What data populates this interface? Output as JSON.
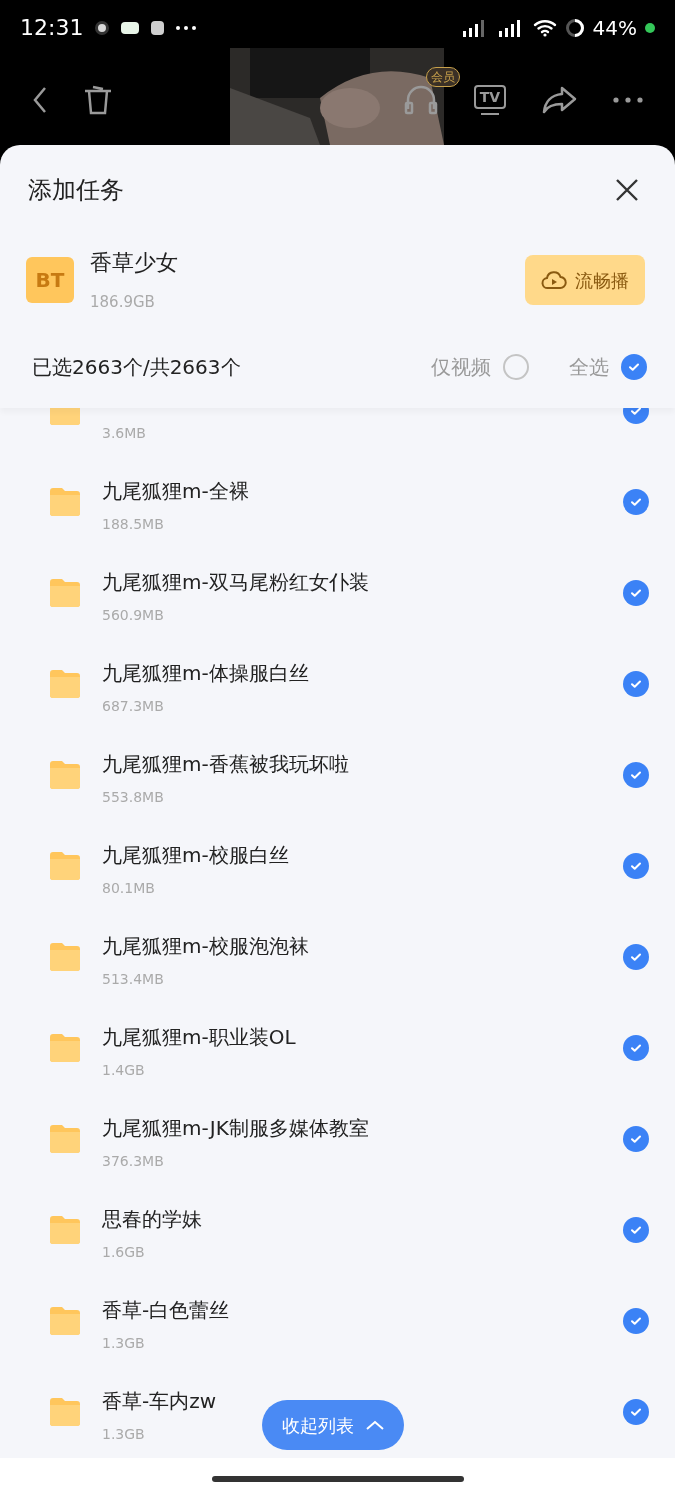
{
  "status_bar": {
    "time": "12:31",
    "battery": "44%"
  },
  "toolbar": {
    "vip_badge": "会员",
    "tv_label": "TV"
  },
  "sheet": {
    "title": "添加任务",
    "torrent": {
      "badge": "BT",
      "name": "香草少女",
      "size": "186.9GB",
      "play_button": "流畅播"
    },
    "selection": {
      "summary": "已选2663个/共2663个",
      "video_only": {
        "label": "仅视频",
        "checked": false
      },
      "select_all": {
        "label": "全选",
        "checked": true
      }
    },
    "items": [
      {
        "size": "3.6MB",
        "checked": true
      },
      {
        "name": "九尾狐狸m-全裸",
        "size": "188.5MB",
        "checked": true
      },
      {
        "name": "九尾狐狸m-双马尾粉红女仆装",
        "size": "560.9MB",
        "checked": true
      },
      {
        "name": "九尾狐狸m-体操服白丝",
        "size": "687.3MB",
        "checked": true
      },
      {
        "name": "九尾狐狸m-香蕉被我玩坏啦",
        "size": "553.8MB",
        "checked": true
      },
      {
        "name": "九尾狐狸m-校服白丝",
        "size": "80.1MB",
        "checked": true
      },
      {
        "name": "九尾狐狸m-校服泡泡袜",
        "size": "513.4MB",
        "checked": true
      },
      {
        "name": "九尾狐狸m-职业装OL",
        "size": "1.4GB",
        "checked": true
      },
      {
        "name": "九尾狐狸m-JK制服多媒体教室",
        "size": "376.3MB",
        "checked": true
      },
      {
        "name": "思春的学妹",
        "size": "1.6GB",
        "checked": true
      },
      {
        "name": "香草-白色蕾丝",
        "size": "1.3GB",
        "checked": true
      },
      {
        "name": "香草-车内zw",
        "size": "1.3GB",
        "checked": true
      }
    ],
    "collapse_button": "收起列表"
  }
}
